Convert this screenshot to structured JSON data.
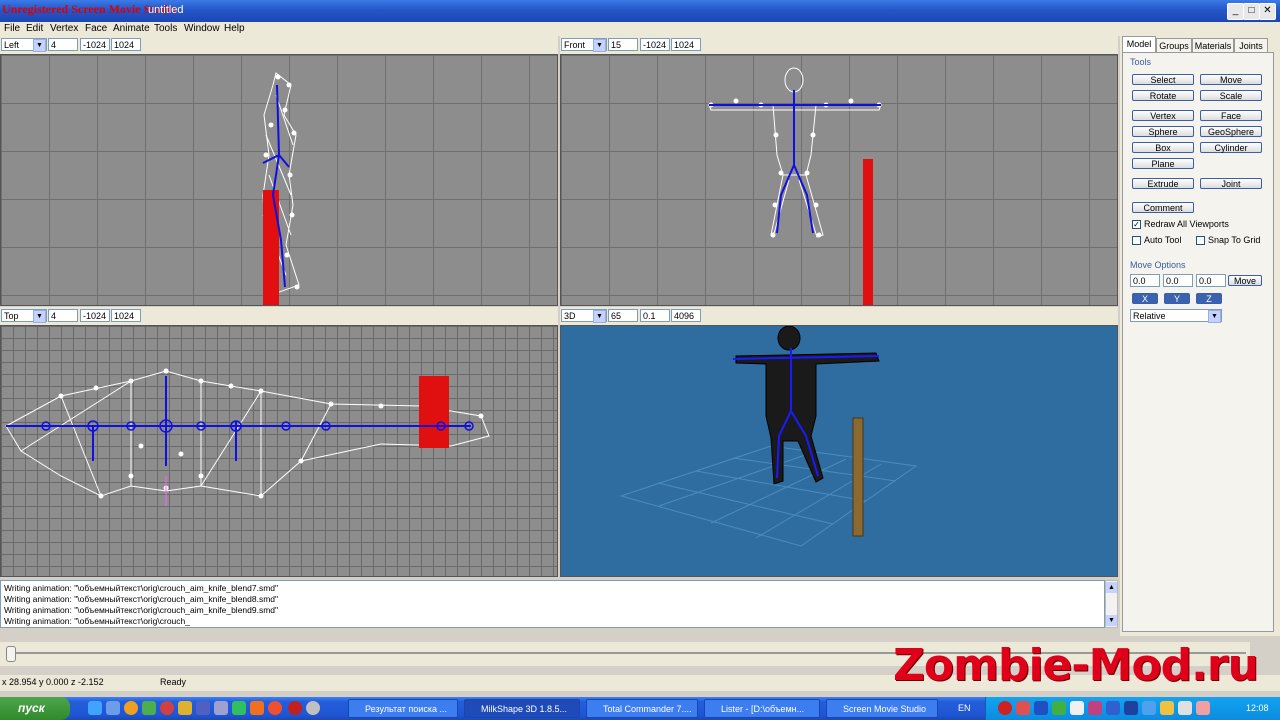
{
  "titlebar": {
    "title": "Unregistered Screen Movie Studio",
    "doc": "untitled",
    "min": "_",
    "max": "□",
    "close": "✕"
  },
  "menu": [
    "File",
    "Edit",
    "Vertex",
    "Face",
    "Animate",
    "Tools",
    "Window",
    "Help"
  ],
  "viewports": {
    "left": {
      "view": "Left",
      "f1": "4",
      "f2": "-1024",
      "f3": "1024"
    },
    "front": {
      "view": "Front",
      "f1": "15",
      "f2": "-1024",
      "f3": "1024"
    },
    "top": {
      "view": "Top",
      "f1": "4",
      "f2": "-1024",
      "f3": "1024"
    },
    "persp": {
      "view": "3D",
      "f1": "65",
      "f2": "0.1",
      "f3": "4096"
    }
  },
  "panel": {
    "tabs": [
      "Model",
      "Groups",
      "Materials",
      "Joints"
    ],
    "tools_label": "Tools",
    "buttons": [
      "Select",
      "Move",
      "Rotate",
      "Scale",
      "Vertex",
      "Face",
      "Sphere",
      "GeoSphere",
      "Box",
      "Cylinder",
      "Plane",
      "Extrude",
      "Joint",
      "Comment"
    ],
    "redraw": "Redraw All Viewports",
    "autotool": "Auto Tool",
    "snap": "Snap To Grid",
    "move_options": "Move Options",
    "mx": "0.0",
    "my": "0.0",
    "mz": "0.0",
    "move_btn": "Move",
    "axis_x": "X",
    "axis_y": "Y",
    "axis_z": "Z",
    "relative": "Relative"
  },
  "log": [
    "Writing animation: \"\\объемныйтекст\\orig\\crouch_aim_knife_blend7.smd\"",
    "Writing animation: \"\\объемныйтекст\\orig\\crouch_aim_knife_blend8.smd\"",
    "Writing animation: \"\\объемныйтекст\\orig\\crouch_aim_knife_blend9.smd\"",
    "Writing animation: \"\\объемныйтекст\\orig\\crouch_"
  ],
  "status": {
    "coords": "x 28.954 y 0.000 z -2.152",
    "state": "Ready"
  },
  "taskbar": {
    "start": "пуск",
    "tasks": [
      "Результат поиска ...",
      "MilkShape 3D 1.8.5...",
      "Total Commander 7....",
      "Lister - [D:\\объемн...",
      "Screen Movie Studio"
    ],
    "lang": "EN",
    "clock": "12:08"
  },
  "watermark": "Zombie-Mod.ru"
}
